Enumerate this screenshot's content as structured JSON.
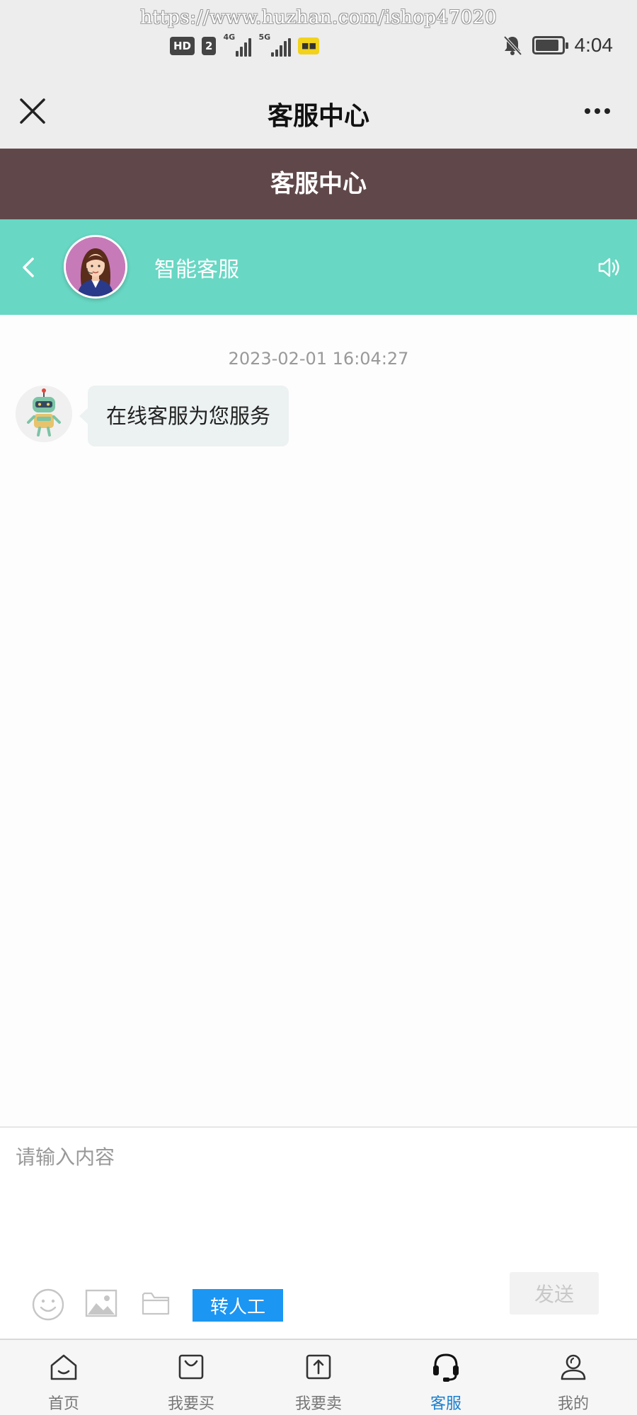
{
  "status_bar": {
    "watermark": "https://www.huzhan.com/ishop47020",
    "hd_label": "HD",
    "sim_label": "2",
    "net1_label": "4G",
    "net2_label": "5G",
    "time": "4:04"
  },
  "nav": {
    "title": "客服中心"
  },
  "header": {
    "title": "客服中心"
  },
  "chat_header": {
    "agent_name": "智能客服"
  },
  "chat": {
    "timestamp": "2023-02-01 16:04:27",
    "messages": [
      {
        "sender": "bot",
        "text": "在线客服为您服务"
      }
    ]
  },
  "input": {
    "placeholder": "请输入内容",
    "send_label": "发送",
    "transfer_label": "转人工"
  },
  "tabs": [
    {
      "label": "首页",
      "icon": "home-icon",
      "active": false
    },
    {
      "label": "我要买",
      "icon": "shopping-bag-icon",
      "active": false
    },
    {
      "label": "我要卖",
      "icon": "upload-icon",
      "active": false
    },
    {
      "label": "客服",
      "icon": "headset-icon",
      "active": true
    },
    {
      "label": "我的",
      "icon": "user-icon",
      "active": false
    }
  ],
  "colors": {
    "header_band": "#60484a",
    "chat_header": "#68d7c3",
    "accent_blue": "#1c96f3",
    "active_tab": "#1a7fcf"
  }
}
